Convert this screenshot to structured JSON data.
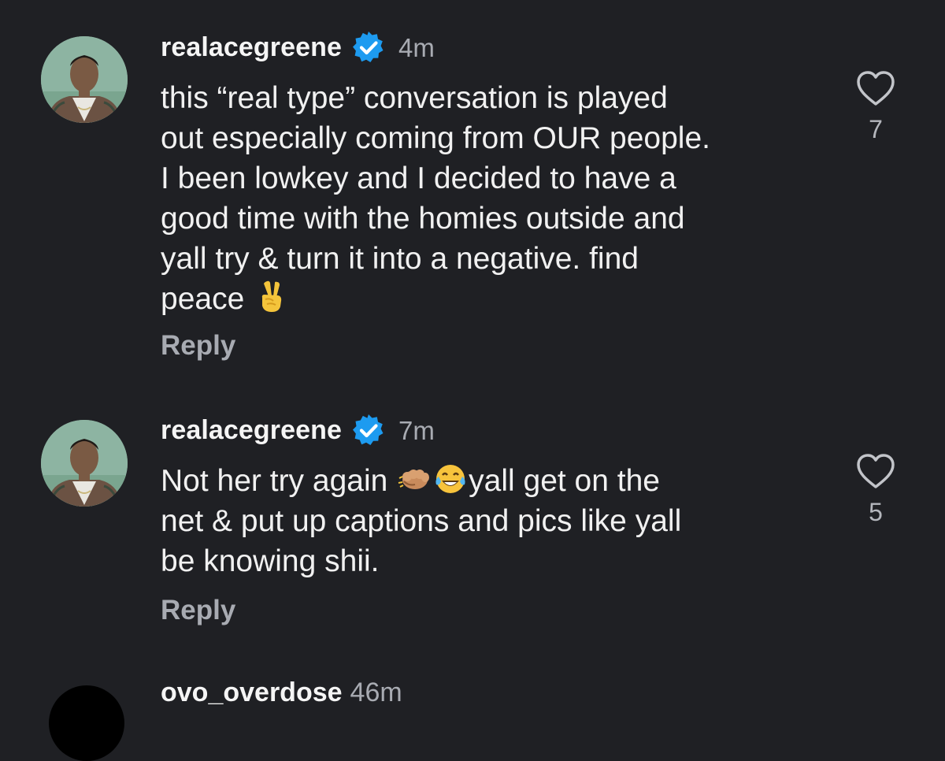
{
  "colors": {
    "background": "#1f2024",
    "verified_blue": "#1d9bf0",
    "secondary_text": "#a8abb2"
  },
  "comments": [
    {
      "avatar_icon": "profile-photo",
      "username": "realacegreene",
      "verified": true,
      "time": "4m",
      "text_before": "this “real type” conversation is played\nout especially coming from OUR people.\nI been lowkey and I decided to have a\ngood time with the homies outside and\nyall try & turn it into a negative. find\npeace ",
      "emoji_1": "victory-hand",
      "reply_label": "Reply",
      "like_count": "7"
    },
    {
      "avatar_icon": "profile-photo",
      "username": "realacegreene",
      "verified": true,
      "time": "7m",
      "text_before": "Not her try again ",
      "emoji_1": "fist-bump",
      "emoji_2": "tears-of-joy",
      "text_after": "yall get on the\nnet & put up captions and pics like yall\nbe knowing shii.",
      "reply_label": "Reply",
      "like_count": "5"
    }
  ],
  "partial_comment": {
    "username": "ovo_overdose",
    "time": "46m"
  }
}
